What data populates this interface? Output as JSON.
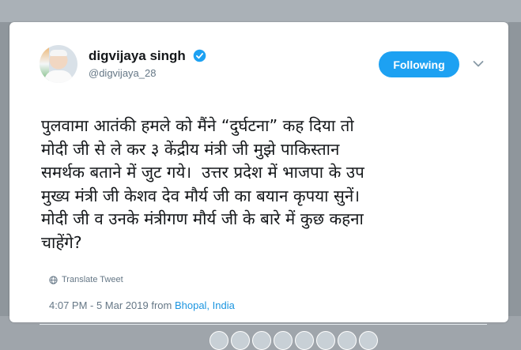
{
  "author": {
    "display_name": "digvijaya singh",
    "handle": "@digvijaya_28",
    "verified": true
  },
  "follow_button_label": "Following",
  "tweet": {
    "text": "पुलवामा आतंकी हमले को मैंने “दुर्घटना” कह दिया तो\nमोदी जी से ले कर ३ केंद्रीय मंत्री जी मुझे पाकिस्तान\nसमर्थक बताने में जुट गये।  उत्तर प्रदेश में भाजपा के उप\nमुख्य मंत्री जी केशव देव मौर्य जी का बयान कृपया सुनें।\nमोदी जी व उनके मंत्रीगण मौर्य जी के बारे में कुछ कहना\nचाहेंगे?",
    "translate_label": "Translate Tweet",
    "time": "4:07 PM - 5 Mar 2019 from ",
    "location": "Bhopal, India"
  },
  "icons": [
    "verified-icon",
    "chevron-down-icon",
    "globe-icon",
    "avatar"
  ],
  "colors": {
    "accent": "#1da1f2",
    "link": "#1b95e0",
    "muted_text": "#657786",
    "text": "#14171a"
  }
}
